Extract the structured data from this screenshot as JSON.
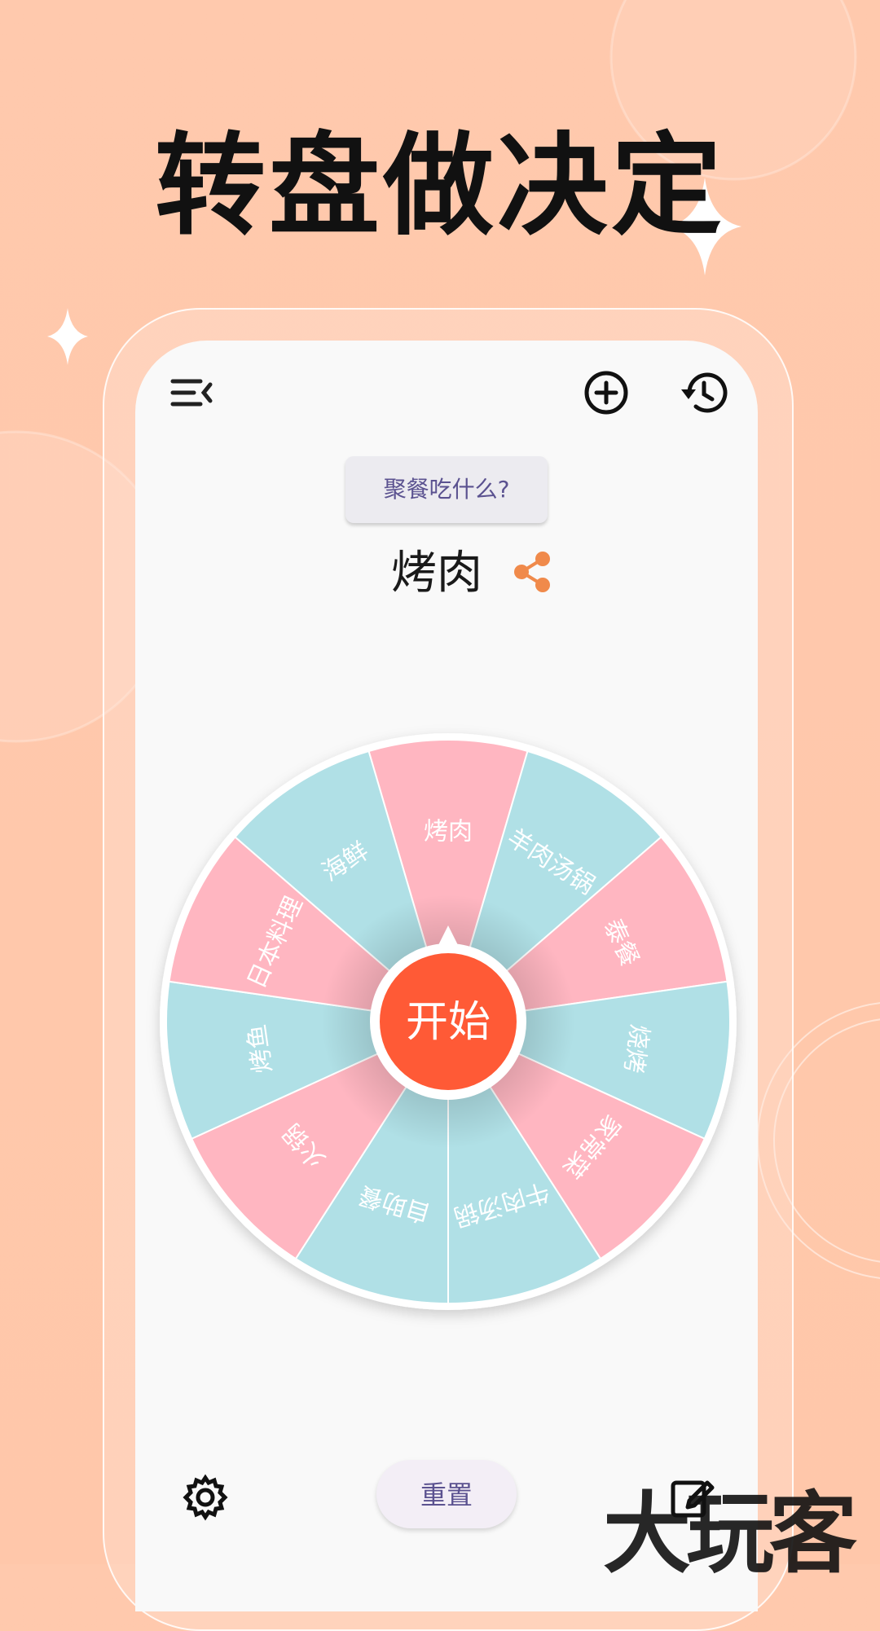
{
  "hero": {
    "title": "转盘做决定"
  },
  "toolbar": {
    "menu_icon": "menu-collapse-icon",
    "add_icon": "add-circle-icon",
    "history_icon": "history-icon"
  },
  "topic": {
    "label": "聚餐吃什么?"
  },
  "result": {
    "value": "烤肉",
    "share_icon": "share-icon"
  },
  "wheel": {
    "start_label": "开始",
    "colors": {
      "pink": "#ffb6c1",
      "teal": "#b0e0e6",
      "center": "#ff5a36",
      "rim": "#ffffff"
    },
    "segments": [
      {
        "label": "烤肉",
        "color": "pink"
      },
      {
        "label": "羊肉汤锅",
        "color": "teal"
      },
      {
        "label": "泰餐",
        "color": "pink"
      },
      {
        "label": "烧烤",
        "color": "teal"
      },
      {
        "label": "家常菜",
        "color": "pink"
      },
      {
        "label": "牛肉汤锅",
        "color": "teal"
      },
      {
        "label": "自助餐",
        "color": "teal"
      },
      {
        "label": "火锅",
        "color": "pink"
      },
      {
        "label": "烤鱼",
        "color": "teal"
      },
      {
        "label": "日本料理",
        "color": "pink"
      },
      {
        "label": "海鲜",
        "color": "teal"
      }
    ]
  },
  "bottom": {
    "settings_icon": "gear-icon",
    "reset_label": "重置",
    "edit_icon": "edit-icon"
  },
  "watermark": {
    "text": "大玩客"
  }
}
